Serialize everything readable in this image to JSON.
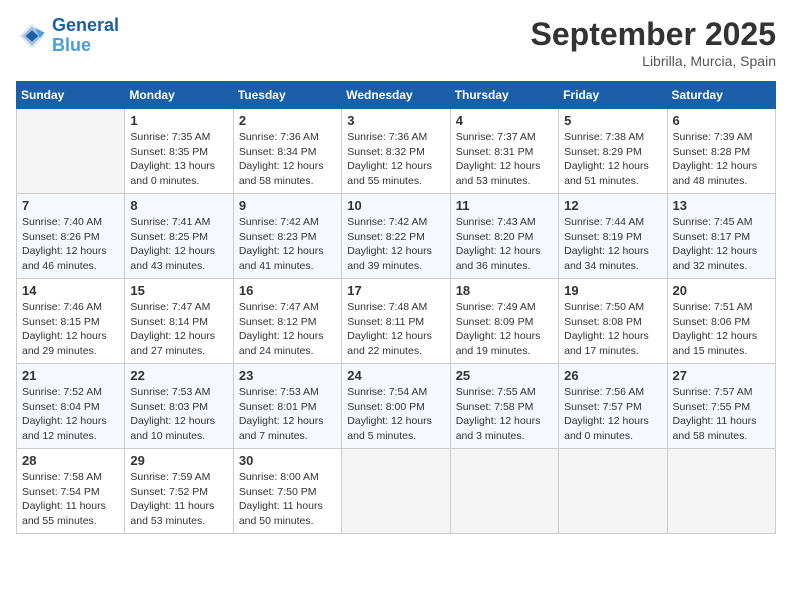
{
  "header": {
    "logo_line1": "General",
    "logo_line2": "Blue",
    "month": "September 2025",
    "location": "Librilla, Murcia, Spain"
  },
  "days_of_week": [
    "Sunday",
    "Monday",
    "Tuesday",
    "Wednesday",
    "Thursday",
    "Friday",
    "Saturday"
  ],
  "weeks": [
    [
      {
        "num": "",
        "info": ""
      },
      {
        "num": "1",
        "info": "Sunrise: 7:35 AM\nSunset: 8:35 PM\nDaylight: 13 hours\nand 0 minutes."
      },
      {
        "num": "2",
        "info": "Sunrise: 7:36 AM\nSunset: 8:34 PM\nDaylight: 12 hours\nand 58 minutes."
      },
      {
        "num": "3",
        "info": "Sunrise: 7:36 AM\nSunset: 8:32 PM\nDaylight: 12 hours\nand 55 minutes."
      },
      {
        "num": "4",
        "info": "Sunrise: 7:37 AM\nSunset: 8:31 PM\nDaylight: 12 hours\nand 53 minutes."
      },
      {
        "num": "5",
        "info": "Sunrise: 7:38 AM\nSunset: 8:29 PM\nDaylight: 12 hours\nand 51 minutes."
      },
      {
        "num": "6",
        "info": "Sunrise: 7:39 AM\nSunset: 8:28 PM\nDaylight: 12 hours\nand 48 minutes."
      }
    ],
    [
      {
        "num": "7",
        "info": "Sunrise: 7:40 AM\nSunset: 8:26 PM\nDaylight: 12 hours\nand 46 minutes."
      },
      {
        "num": "8",
        "info": "Sunrise: 7:41 AM\nSunset: 8:25 PM\nDaylight: 12 hours\nand 43 minutes."
      },
      {
        "num": "9",
        "info": "Sunrise: 7:42 AM\nSunset: 8:23 PM\nDaylight: 12 hours\nand 41 minutes."
      },
      {
        "num": "10",
        "info": "Sunrise: 7:42 AM\nSunset: 8:22 PM\nDaylight: 12 hours\nand 39 minutes."
      },
      {
        "num": "11",
        "info": "Sunrise: 7:43 AM\nSunset: 8:20 PM\nDaylight: 12 hours\nand 36 minutes."
      },
      {
        "num": "12",
        "info": "Sunrise: 7:44 AM\nSunset: 8:19 PM\nDaylight: 12 hours\nand 34 minutes."
      },
      {
        "num": "13",
        "info": "Sunrise: 7:45 AM\nSunset: 8:17 PM\nDaylight: 12 hours\nand 32 minutes."
      }
    ],
    [
      {
        "num": "14",
        "info": "Sunrise: 7:46 AM\nSunset: 8:15 PM\nDaylight: 12 hours\nand 29 minutes."
      },
      {
        "num": "15",
        "info": "Sunrise: 7:47 AM\nSunset: 8:14 PM\nDaylight: 12 hours\nand 27 minutes."
      },
      {
        "num": "16",
        "info": "Sunrise: 7:47 AM\nSunset: 8:12 PM\nDaylight: 12 hours\nand 24 minutes."
      },
      {
        "num": "17",
        "info": "Sunrise: 7:48 AM\nSunset: 8:11 PM\nDaylight: 12 hours\nand 22 minutes."
      },
      {
        "num": "18",
        "info": "Sunrise: 7:49 AM\nSunset: 8:09 PM\nDaylight: 12 hours\nand 19 minutes."
      },
      {
        "num": "19",
        "info": "Sunrise: 7:50 AM\nSunset: 8:08 PM\nDaylight: 12 hours\nand 17 minutes."
      },
      {
        "num": "20",
        "info": "Sunrise: 7:51 AM\nSunset: 8:06 PM\nDaylight: 12 hours\nand 15 minutes."
      }
    ],
    [
      {
        "num": "21",
        "info": "Sunrise: 7:52 AM\nSunset: 8:04 PM\nDaylight: 12 hours\nand 12 minutes."
      },
      {
        "num": "22",
        "info": "Sunrise: 7:53 AM\nSunset: 8:03 PM\nDaylight: 12 hours\nand 10 minutes."
      },
      {
        "num": "23",
        "info": "Sunrise: 7:53 AM\nSunset: 8:01 PM\nDaylight: 12 hours\nand 7 minutes."
      },
      {
        "num": "24",
        "info": "Sunrise: 7:54 AM\nSunset: 8:00 PM\nDaylight: 12 hours\nand 5 minutes."
      },
      {
        "num": "25",
        "info": "Sunrise: 7:55 AM\nSunset: 7:58 PM\nDaylight: 12 hours\nand 3 minutes."
      },
      {
        "num": "26",
        "info": "Sunrise: 7:56 AM\nSunset: 7:57 PM\nDaylight: 12 hours\nand 0 minutes."
      },
      {
        "num": "27",
        "info": "Sunrise: 7:57 AM\nSunset: 7:55 PM\nDaylight: 11 hours\nand 58 minutes."
      }
    ],
    [
      {
        "num": "28",
        "info": "Sunrise: 7:58 AM\nSunset: 7:54 PM\nDaylight: 11 hours\nand 55 minutes."
      },
      {
        "num": "29",
        "info": "Sunrise: 7:59 AM\nSunset: 7:52 PM\nDaylight: 11 hours\nand 53 minutes."
      },
      {
        "num": "30",
        "info": "Sunrise: 8:00 AM\nSunset: 7:50 PM\nDaylight: 11 hours\nand 50 minutes."
      },
      {
        "num": "",
        "info": ""
      },
      {
        "num": "",
        "info": ""
      },
      {
        "num": "",
        "info": ""
      },
      {
        "num": "",
        "info": ""
      }
    ]
  ]
}
